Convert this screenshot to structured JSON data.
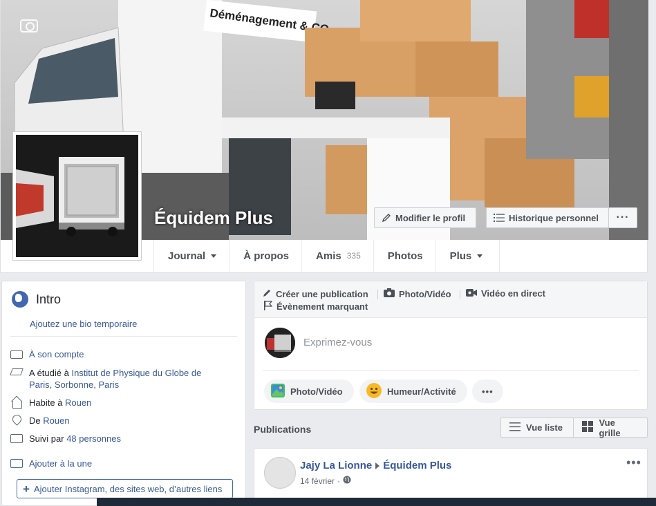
{
  "profile": {
    "name": "Équidem Plus",
    "cover_sign_text": "Déménagement & CO",
    "buttons": {
      "edit_profile": "Modifier le profil",
      "history": "Historique personnel",
      "more": "···"
    }
  },
  "tabs": [
    {
      "label": "Journal",
      "caret": true
    },
    {
      "label": "À propos"
    },
    {
      "label": "Amis",
      "count": "335"
    },
    {
      "label": "Photos"
    },
    {
      "label": "Plus",
      "caret": true
    }
  ],
  "intro": {
    "title": "Intro",
    "bio_link": "Ajoutez une bio temporaire",
    "items": {
      "account": "À son compte",
      "studied_prefix": "A étudié à ",
      "studied_link": "Institut de Physique du Globe de Paris, Sorbonne, Paris",
      "lives_prefix": "Habite à ",
      "lives_link": "Rouen",
      "from_prefix": "De ",
      "from_link": "Rouen",
      "followed_prefix": "Suivi par ",
      "followed_link": "48 personnes"
    },
    "featured_link": "Ajouter à la une",
    "add_links_button": "Ajouter Instagram, des sites web, d’autres liens"
  },
  "composer": {
    "actions": {
      "create_post": "Créer une publication",
      "photo_video": "Photo/Vidéo",
      "live_video": "Vidéo en direct",
      "life_event": "Évènement marquant"
    },
    "placeholder": "Exprimez-vous",
    "pills": {
      "photo_video": "Photo/Vidéo",
      "feeling": "Humeur/Activité",
      "more": "•••"
    }
  },
  "publications": {
    "label": "Publications",
    "list_view": "Vue liste",
    "grid_view": "Vue grille"
  },
  "post": {
    "author": "Jajy La Lionne",
    "target": "Équidem Plus",
    "date": "14 février",
    "more": "•••"
  },
  "colors": {
    "link": "#385898",
    "accent": "#4267b2",
    "background": "#e9ebee"
  }
}
